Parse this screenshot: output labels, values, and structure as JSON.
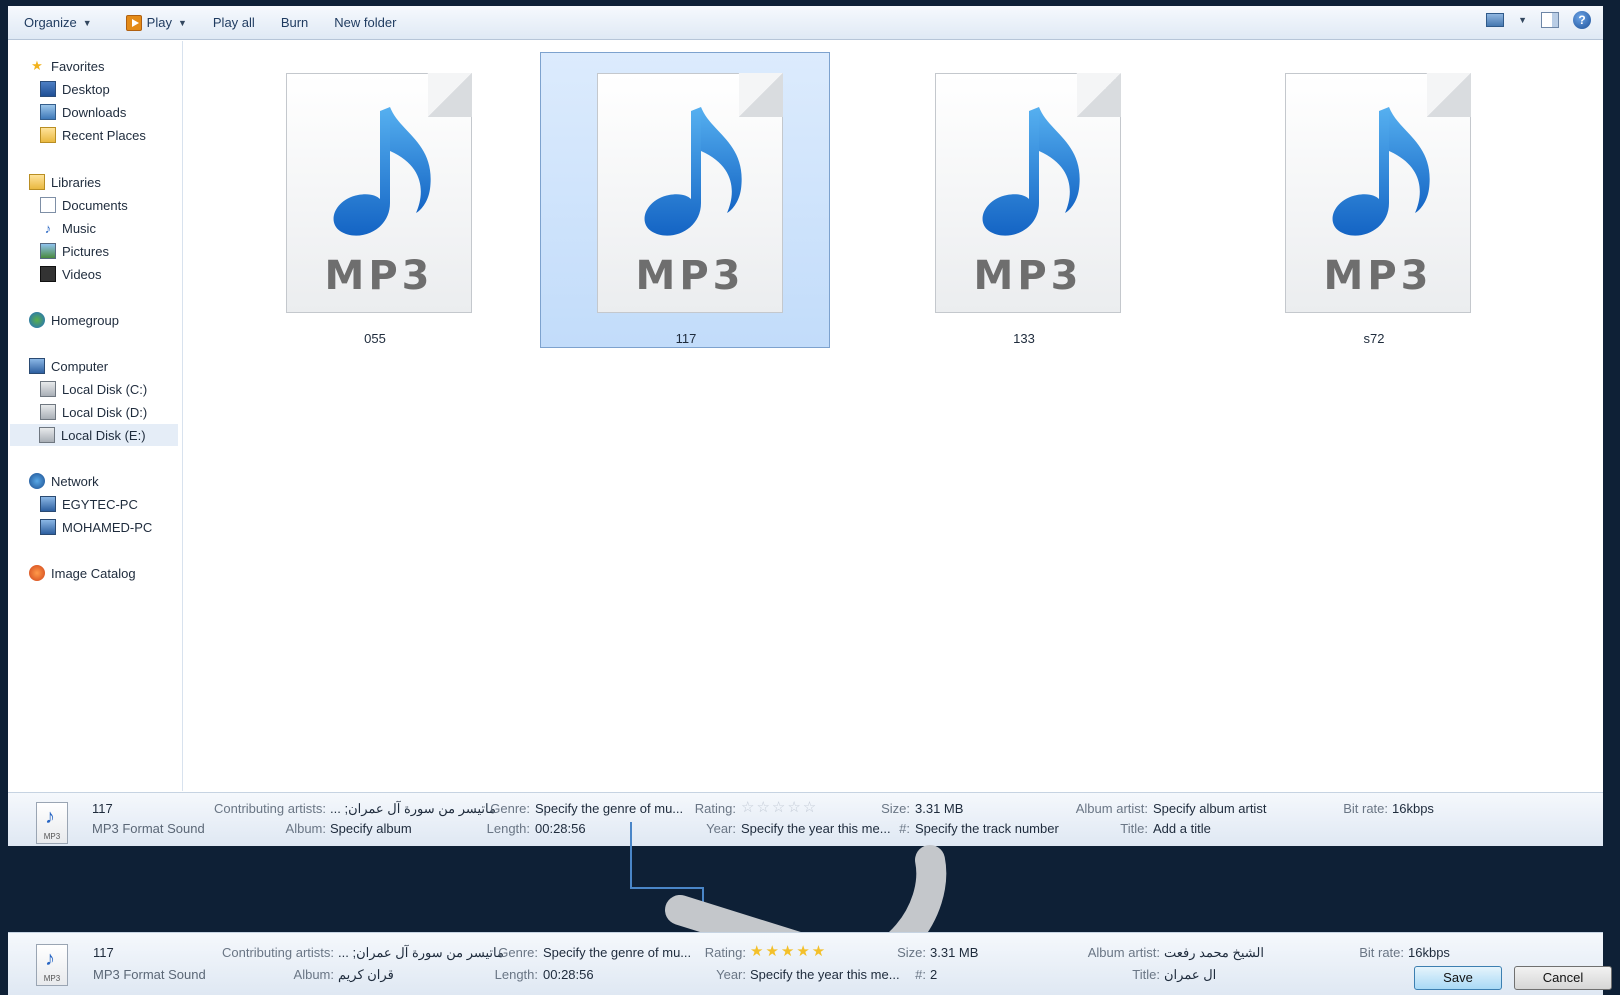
{
  "toolbar": {
    "organize": "Organize",
    "play": "Play",
    "play_all": "Play all",
    "burn": "Burn",
    "new_folder": "New folder",
    "help": "?"
  },
  "nav": {
    "favorites": "Favorites",
    "desktop": "Desktop",
    "downloads": "Downloads",
    "recent_places": "Recent Places",
    "libraries": "Libraries",
    "documents": "Documents",
    "music": "Music",
    "pictures": "Pictures",
    "videos": "Videos",
    "homegroup": "Homegroup",
    "computer": "Computer",
    "disk_c": "Local Disk (C:)",
    "disk_d": "Local Disk (D:)",
    "disk_e": "Local Disk (E:)",
    "network": "Network",
    "pc1": "EGYTEC-PC",
    "pc2": "MOHAMED-PC",
    "image_catalog": "Image Catalog"
  },
  "files": [
    {
      "name": "055",
      "type_label": "MP3"
    },
    {
      "name": "117",
      "type_label": "MP3"
    },
    {
      "name": "133",
      "type_label": "MP3"
    },
    {
      "name": "s72",
      "type_label": "MP3"
    }
  ],
  "details_before": {
    "icon_label": "MP3",
    "name": "117",
    "type": "MP3 Format Sound",
    "contributing_artists_label": "Contributing artists:",
    "contributing_artists": "... ;ماتيسر من سورة آل عمران",
    "album_label": "Album:",
    "album": "Specify album",
    "genre_label": "Genre:",
    "genre": "Specify the genre of mu...",
    "length_label": "Length:",
    "length": "00:28:56",
    "rating_label": "Rating:",
    "rating": 0,
    "year_label": "Year:",
    "year": "Specify the year this me...",
    "size_label": "Size:",
    "size": "3.31 MB",
    "track_label": "#:",
    "track": "Specify the track number",
    "album_artist_label": "Album artist:",
    "album_artist": "Specify album artist",
    "title_label": "Title:",
    "title": "Add a title",
    "bitrate_label": "Bit rate:",
    "bitrate": "16kbps"
  },
  "details_after": {
    "icon_label": "MP3",
    "name": "117",
    "type": "MP3 Format Sound",
    "contributing_artists_label": "Contributing artists:",
    "contributing_artists": "... ;ماتيسر من سورة آل عمران",
    "album_label": "Album:",
    "album": "قران كريم",
    "genre_label": "Genre:",
    "genre": "Specify the genre of mu...",
    "length_label": "Length:",
    "length": "00:28:56",
    "rating_label": "Rating:",
    "rating": 5,
    "year_label": "Year:",
    "year": "Specify the year this me...",
    "size_label": "Size:",
    "size": "3.31 MB",
    "track_label": "#:",
    "track": "2",
    "album_artist_label": "Album artist:",
    "album_artist": "الشيخ محمد رفعت",
    "title_label": "Title:",
    "title": "ال عمران",
    "bitrate_label": "Bit rate:",
    "bitrate": "16kbps",
    "save": "Save",
    "cancel": "Cancel"
  },
  "colors": {
    "background": "#0e2036",
    "selection": "#c2dcfa",
    "star_full": "#f3c02a",
    "star_empty": "#c3cbd6",
    "note_blue": "#2a7fd8"
  }
}
